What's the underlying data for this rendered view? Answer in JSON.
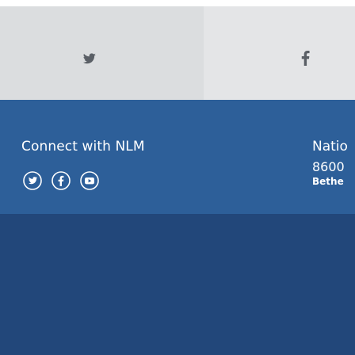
{
  "colors": {
    "share_bar": "#dfe1e2",
    "footer_bg": "#2d5f99",
    "footer_bottom": "#22477a",
    "icon_gray": "#5a5f66",
    "text_white": "#ffffff"
  },
  "share": {
    "items": [
      {
        "icon": "twitter-icon"
      },
      {
        "icon": "facebook-icon"
      }
    ]
  },
  "footer": {
    "connect_title": "Connect with NLM",
    "social": [
      {
        "icon": "twitter-icon"
      },
      {
        "icon": "facebook-icon"
      },
      {
        "icon": "youtube-icon"
      }
    ],
    "address": {
      "org": "Natio",
      "street": "8600",
      "city": "Bethe"
    }
  }
}
